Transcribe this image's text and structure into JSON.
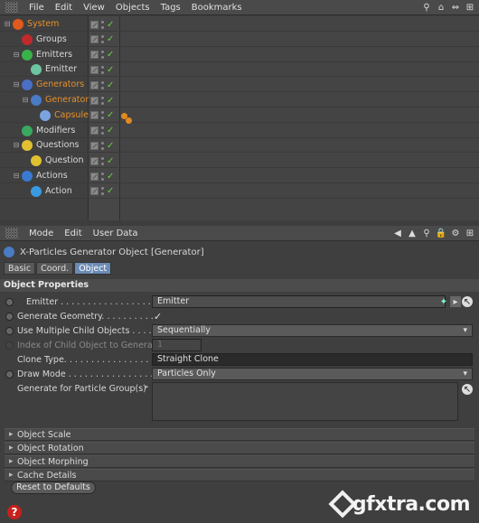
{
  "om_menu": {
    "file": "File",
    "edit": "Edit",
    "view": "View",
    "objects": "Objects",
    "tags": "Tags",
    "bookmarks": "Bookmarks"
  },
  "tree": [
    {
      "label": "System",
      "orange": true,
      "color": "#e05a1c"
    },
    {
      "label": "Groups",
      "orange": false,
      "color": "#c02a2a"
    },
    {
      "label": "Emitters",
      "orange": false,
      "color": "#39b24a"
    },
    {
      "label": "Emitter",
      "orange": false,
      "color": "#6cc5a0"
    },
    {
      "label": "Generators",
      "orange": true,
      "color": "#4a6fc4"
    },
    {
      "label": "Generator",
      "orange": true,
      "color": "#4a7bc4"
    },
    {
      "label": "Capsule",
      "orange": true,
      "color": "#7aa4e0"
    },
    {
      "label": "Modifiers",
      "orange": false,
      "color": "#3aa860"
    },
    {
      "label": "Questions",
      "orange": false,
      "color": "#e0c030"
    },
    {
      "label": "Question",
      "orange": false,
      "color": "#e0c030"
    },
    {
      "label": "Actions",
      "orange": false,
      "color": "#3a7ad0"
    },
    {
      "label": "Action",
      "orange": false,
      "color": "#3a9ae0"
    }
  ],
  "am_menu": {
    "mode": "Mode",
    "edit": "Edit",
    "user_data": "User Data"
  },
  "object_title": "X-Particles Generator Object [Generator]",
  "tabs": [
    "Basic",
    "Coord.",
    "Object"
  ],
  "section": "Object Properties",
  "props": {
    "emitter_label": "Emitter . . . . . . . . . . . . . . . . . . .",
    "emitter_value": "Emitter",
    "gen_geom_label": "Generate Geometry. . . . . . . . . . . . .",
    "gen_geom_value": "✓",
    "multi_child_label": "Use Multiple Child Objects . . . . . .",
    "multi_child_value": "Sequentially",
    "index_label": "Index of Child Object to Generate",
    "index_value": "1",
    "clone_label": "Clone Type. . . . . . . . . . . . . . . . . . .",
    "clone_value": "Straight Clone",
    "draw_label": "Draw Mode . . . . . . . . . . . . . . . . . .",
    "draw_value": "Particles Only",
    "groups_label": "Generate for Particle Group(s)"
  },
  "collapsibles": [
    "Object Scale",
    "Object Rotation",
    "Object Morphing",
    "Cache Details"
  ],
  "reset_button": "Reset to Defaults",
  "watermark": "gfxtra.com"
}
